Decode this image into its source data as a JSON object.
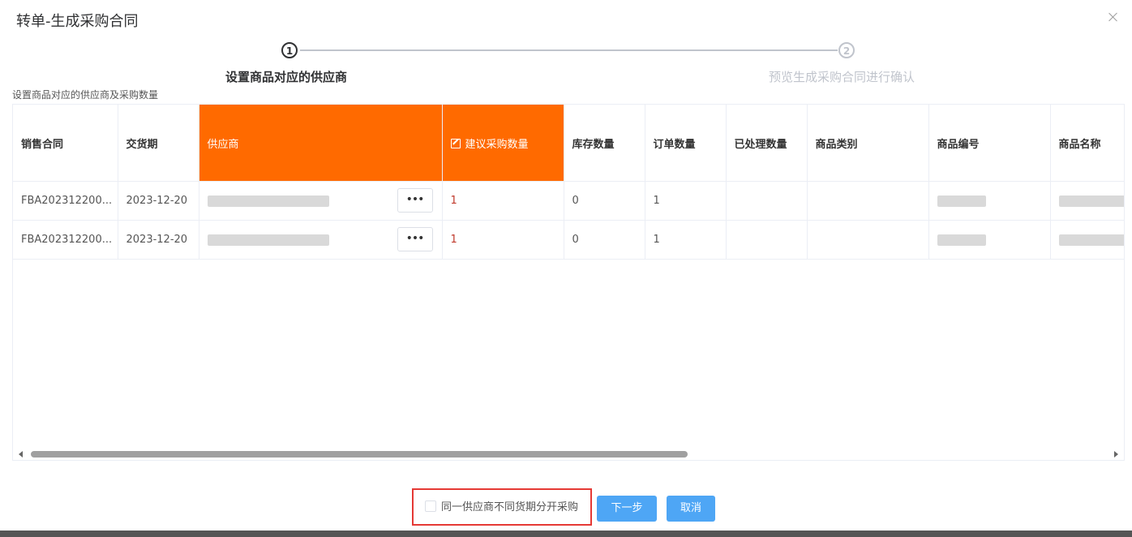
{
  "dialog": {
    "title": "转单-生成采购合同"
  },
  "steps": [
    {
      "number": "1",
      "title": "设置商品对应的供应商"
    },
    {
      "number": "2",
      "title": "预览生成采购合同进行确认"
    }
  ],
  "section_label": "设置商品对应的供应商及采购数量",
  "table": {
    "columns": [
      "销售合同",
      "交货期",
      "供应商",
      "建议采购数量",
      "库存数量",
      "订单数量",
      "已处理数量",
      "商品类别",
      "商品编号",
      "商品名称"
    ],
    "rows": [
      {
        "contract": "FBA202312200...",
        "delivery": "2023-12-20",
        "dots": "•••",
        "suggested_qty": "1",
        "stock_qty": "0",
        "order_qty": "1",
        "processed_qty": "",
        "category": ""
      },
      {
        "contract": "FBA202312200...",
        "delivery": "2023-12-20",
        "dots": "•••",
        "suggested_qty": "1",
        "stock_qty": "0",
        "order_qty": "1",
        "processed_qty": "",
        "category": ""
      }
    ],
    "scroll_fraction": 0.61
  },
  "footer": {
    "checkbox_label": "同一供应商不同货期分开采购",
    "checkbox_checked": false,
    "next_button": "下一步",
    "cancel_button": "取消"
  },
  "colors": {
    "highlight_header": "#ff6a00",
    "primary_button": "#4ea6f5",
    "outline_red": "#e53935"
  }
}
